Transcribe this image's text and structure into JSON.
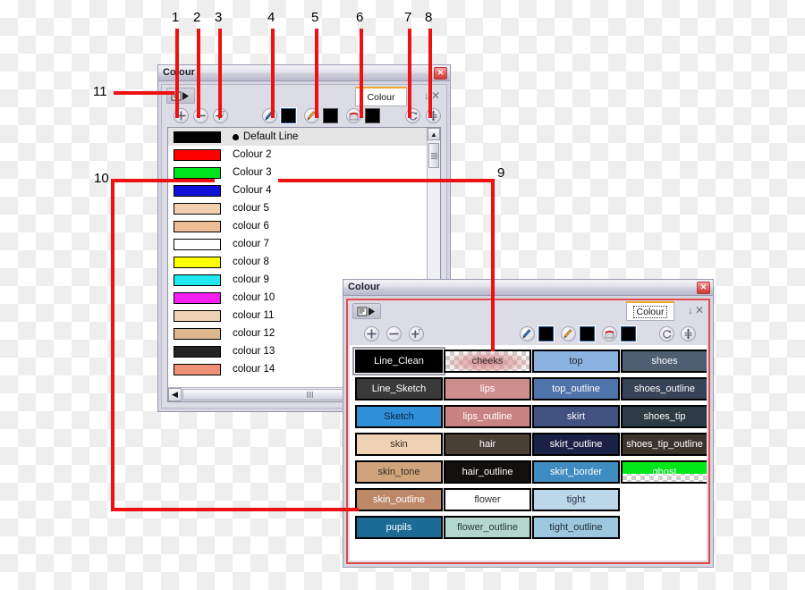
{
  "window1": {
    "title": "Colour",
    "close_label": "✕",
    "tab_label": "Colour",
    "tab_controls": [
      "↓",
      "|",
      "✕"
    ],
    "menu_button": "menu-list-icon",
    "toolbar": [
      {
        "name": "add-colour-button",
        "icon": "plus-circle-icon"
      },
      {
        "name": "remove-colour-button",
        "icon": "minus-circle-icon"
      },
      {
        "name": "add-text-colour-button",
        "icon": "plus-t-circle-icon"
      },
      {
        "name": "pen-style-icon",
        "icon": "pen-icon"
      },
      {
        "name": "pen-colour-swatch",
        "icon": "black-swatch"
      },
      {
        "name": "pencil-style-icon",
        "icon": "pencil-icon"
      },
      {
        "name": "pencil-colour-swatch",
        "icon": "black-swatch"
      },
      {
        "name": "paint-style-icon",
        "icon": "paint-can-icon"
      },
      {
        "name": "paint-colour-swatch",
        "icon": "black-swatch"
      },
      {
        "name": "reset-button",
        "icon": "circular-arrow-icon"
      },
      {
        "name": "expand-button",
        "icon": "up-down-arrow-icon"
      }
    ],
    "colours": [
      {
        "name": "Default Line",
        "hex": "#000000",
        "selected": true,
        "bullet": true
      },
      {
        "name": "Colour 2",
        "hex": "#fe0000",
        "selected": false,
        "bullet": false
      },
      {
        "name": "Colour 3",
        "hex": "#00e61e",
        "selected": false,
        "bullet": false
      },
      {
        "name": "Colour 4",
        "hex": "#1010d8",
        "selected": false,
        "bullet": false
      },
      {
        "name": "colour 5",
        "hex": "#f2cfaf",
        "selected": false,
        "bullet": false
      },
      {
        "name": "colour 6",
        "hex": "#eebe96",
        "selected": false,
        "bullet": false
      },
      {
        "name": "colour 7",
        "hex": "#ffffff",
        "selected": false,
        "bullet": false
      },
      {
        "name": "colour 8",
        "hex": "#ffff00",
        "selected": false,
        "bullet": false
      },
      {
        "name": "colour 9",
        "hex": "#22e8ef",
        "selected": false,
        "bullet": false
      },
      {
        "name": "colour 10",
        "hex": "#f620f0",
        "selected": false,
        "bullet": false
      },
      {
        "name": "colour 11",
        "hex": "#edd3b4",
        "selected": false,
        "bullet": false
      },
      {
        "name": "colour 12",
        "hex": "#ddb78e",
        "selected": false,
        "bullet": false
      },
      {
        "name": "colour 13",
        "hex": "#242424",
        "selected": false,
        "bullet": false
      },
      {
        "name": "colour 14",
        "hex": "#f09077",
        "selected": false,
        "bullet": false
      }
    ],
    "scroll_up_glyph": "▲",
    "scroll_left_glyph": "◀"
  },
  "window2": {
    "title": "Colour",
    "close_label": "✕",
    "tab_label": "Colour",
    "tab_controls": [
      "↓",
      "|",
      "✕"
    ],
    "menu_button": "menu-list-icon",
    "toolbar": [
      {
        "name": "add-colour-button",
        "icon": "plus-circle-icon"
      },
      {
        "name": "remove-colour-button",
        "icon": "minus-circle-icon"
      },
      {
        "name": "add-text-colour-button",
        "icon": "plus-t-circle-icon"
      },
      {
        "name": "pen-style-icon",
        "icon": "pen-icon"
      },
      {
        "name": "pen-colour-swatch",
        "icon": "black-swatch"
      },
      {
        "name": "pencil-style-icon",
        "icon": "pencil-icon"
      },
      {
        "name": "pencil-colour-swatch",
        "icon": "black-swatch"
      },
      {
        "name": "paint-style-icon",
        "icon": "paint-can-icon"
      },
      {
        "name": "paint-colour-swatch",
        "icon": "black-swatch"
      },
      {
        "name": "reset-button",
        "icon": "circular-arrow-icon"
      },
      {
        "name": "expand-button",
        "icon": "up-down-arrow-icon"
      }
    ],
    "palette": [
      {
        "label": "Line_Clean",
        "bg": "#000000",
        "fg": "#ffffff",
        "selected": true,
        "checker": false
      },
      {
        "label": "cheeks",
        "bg": "#d98f8f",
        "fg": "#2b2b2b",
        "selected": false,
        "checker": true
      },
      {
        "label": "top",
        "bg": "#8cb2e2",
        "fg": "#222b38",
        "selected": false,
        "checker": false
      },
      {
        "label": "shoes",
        "bg": "#4e5f72",
        "fg": "#ffffff",
        "selected": false,
        "checker": false
      },
      {
        "label": "Line_Sketch",
        "bg": "#3a3a3a",
        "fg": "#ffffff",
        "selected": false,
        "checker": false
      },
      {
        "label": "lips",
        "bg": "#cf8e8e",
        "fg": "#ffffff",
        "selected": false,
        "checker": false
      },
      {
        "label": "top_outline",
        "bg": "#4f74ab",
        "fg": "#ffffff",
        "selected": false,
        "checker": false
      },
      {
        "label": "shoes_outline",
        "bg": "#374356",
        "fg": "#ffffff",
        "selected": false,
        "checker": false
      },
      {
        "label": "Sketch",
        "bg": "#2f90d8",
        "fg": "#0a2238",
        "selected": false,
        "checker": false
      },
      {
        "label": "lips_outline",
        "bg": "#c98383",
        "fg": "#ffffff",
        "selected": false,
        "checker": false
      },
      {
        "label": "skirt",
        "bg": "#415280",
        "fg": "#ffffff",
        "selected": false,
        "checker": false
      },
      {
        "label": "shoes_tip",
        "bg": "#2c3b44",
        "fg": "#ffffff",
        "selected": false,
        "checker": false
      },
      {
        "label": "skin",
        "bg": "#efd2b3",
        "fg": "#3a3024",
        "selected": false,
        "checker": false
      },
      {
        "label": "hair",
        "bg": "#493f34",
        "fg": "#ffffff",
        "selected": false,
        "checker": false
      },
      {
        "label": "skirt_outline",
        "bg": "#1c2246",
        "fg": "#ffffff",
        "selected": false,
        "checker": false
      },
      {
        "label": "shoes_tip_outline",
        "bg": "#3b342d",
        "fg": "#ffffff",
        "selected": false,
        "checker": false
      },
      {
        "label": "skin_tone",
        "bg": "#cfa37c",
        "fg": "#3a2e20",
        "selected": false,
        "checker": false
      },
      {
        "label": "hair_outline",
        "bg": "#120f0d",
        "fg": "#ffffff",
        "selected": false,
        "checker": false
      },
      {
        "label": "skirt_border",
        "bg": "#3f8cc0",
        "fg": "#ffffff",
        "selected": false,
        "checker": false
      },
      {
        "label": "ghost",
        "bg": "#00e81a",
        "fg": "#ffffff",
        "selected": false,
        "checker": true
      },
      {
        "label": "skin_outline",
        "bg": "#bc8868",
        "fg": "#ffffff",
        "selected": false,
        "checker": false
      },
      {
        "label": "flower",
        "bg": "#ffffff",
        "fg": "#2b2b2b",
        "selected": false,
        "checker": false
      },
      {
        "label": "tight",
        "bg": "#bcd7ea",
        "fg": "#243440",
        "selected": false,
        "checker": false
      },
      {
        "label": "",
        "bg": "#ffffff",
        "fg": "#ffffff",
        "selected": false,
        "checker": false
      },
      {
        "label": "pupils",
        "bg": "#1b6b94",
        "fg": "#ffffff",
        "selected": false,
        "checker": false
      },
      {
        "label": "flower_outline",
        "bg": "#b3d6ce",
        "fg": "#2b3b38",
        "selected": false,
        "checker": false
      },
      {
        "label": "tight_outline",
        "bg": "#9dc7de",
        "fg": "#1e2e38",
        "selected": false,
        "checker": false
      },
      {
        "label": "",
        "bg": "#ffffff",
        "fg": "#ffffff",
        "selected": false,
        "checker": false
      }
    ]
  },
  "callouts": {
    "accent_hex": "#ee1111",
    "labels": [
      "1",
      "2",
      "3",
      "4",
      "5",
      "6",
      "7",
      "8",
      "9",
      "10",
      "11"
    ]
  }
}
